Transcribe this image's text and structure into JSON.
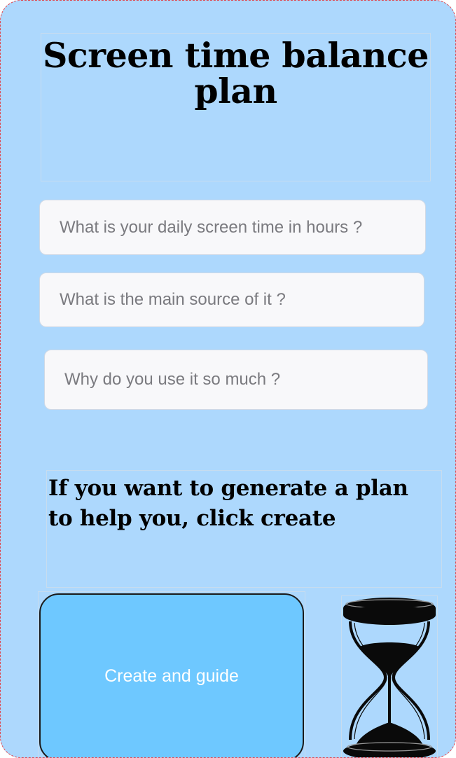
{
  "title": "Screen time balance plan",
  "fields": {
    "screen_time": {
      "placeholder": "What is your daily screen time in hours ?",
      "value": ""
    },
    "main_source": {
      "placeholder": "What is the main source of it ?",
      "value": ""
    },
    "reason": {
      "placeholder": "Why do you use it so much ?",
      "value": ""
    }
  },
  "prompt": "If you want to generate a plan to help you, click create",
  "button": {
    "label": "Create and guide"
  },
  "icon": {
    "name": "hourglass-icon"
  },
  "colors": {
    "background": "#add8fd",
    "button": "#6ec8ff",
    "field": "#f8f8fa",
    "text": "#000000"
  }
}
